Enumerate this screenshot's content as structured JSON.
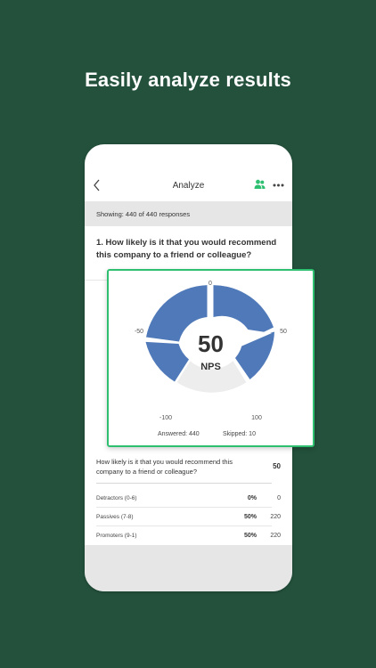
{
  "headline": "Easily analyze results",
  "navbar": {
    "title": "Analyze"
  },
  "showing": "Showing: 440 of 440 responses",
  "question": "1. How likely is it that you would recommend this company to a friend or colleague?",
  "nps_card": {
    "score": "50",
    "score_label": "NPS",
    "ticks": {
      "top": "0",
      "left": "-50",
      "right": "50",
      "bottom_left": "-100",
      "bottom_right": "100"
    },
    "answered": "Answered: 440",
    "skipped": "Skipped: 10",
    "colors": {
      "segment": "#4f79b8",
      "empty": "#ededed",
      "border": "#2fbf71"
    }
  },
  "summary": {
    "question": "How likely is it that you would recommend this company to a friend or colleague?",
    "score": "50",
    "rows": [
      {
        "label": "Detractors (0-6)",
        "percent": "0%",
        "count": "0"
      },
      {
        "label": "Passives (7-8)",
        "percent": "50%",
        "count": "220"
      },
      {
        "label": "Promoters (9-1)",
        "percent": "50%",
        "count": "220"
      }
    ]
  },
  "colors": {
    "background": "#23513c",
    "accent": "#2fbf71"
  }
}
